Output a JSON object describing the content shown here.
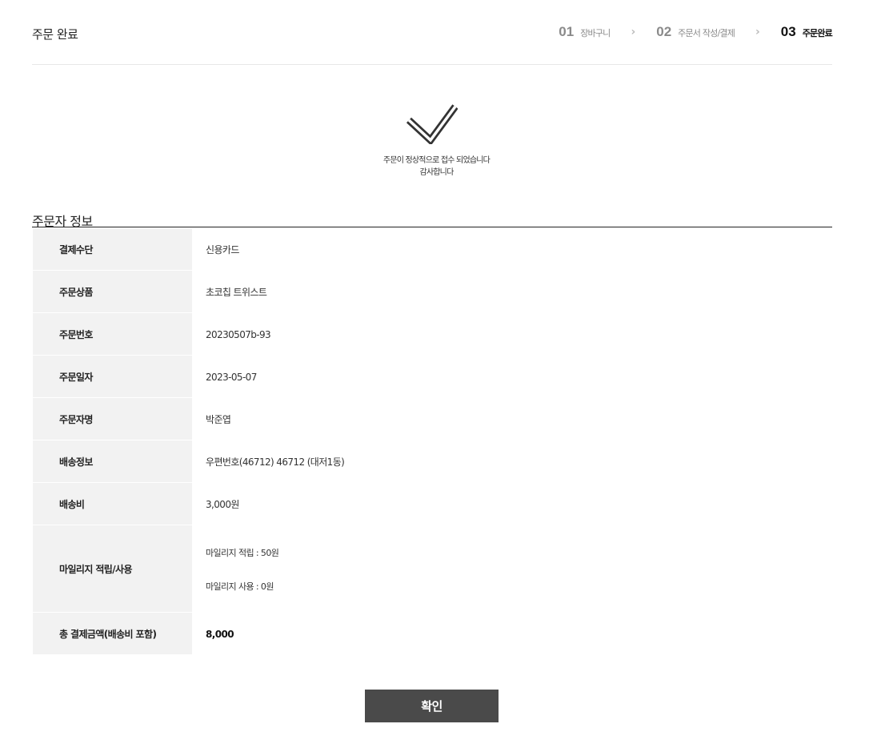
{
  "header": {
    "title": "주문 완료",
    "steps": [
      {
        "num": "01",
        "label": "장바구니"
      },
      {
        "num": "02",
        "label": "주문서 작성/결제"
      },
      {
        "num": "03",
        "label": "주문완료"
      }
    ],
    "separator": "›"
  },
  "complete": {
    "icon": "check-icon",
    "line1": "주문이 정상적으로 접수 되었습니다",
    "line2": "감사합니다"
  },
  "orderer_info": {
    "title": "주문자 정보",
    "rows": [
      {
        "label": "결제수단",
        "value": "신용카드"
      },
      {
        "label": "주문상품",
        "value": "초코칩 트위스트"
      },
      {
        "label": "주문번호",
        "value": "20230507b-93"
      },
      {
        "label": "주문일자",
        "value": "2023-05-07"
      },
      {
        "label": "주문자명",
        "value": "박준엽"
      },
      {
        "label": "배송정보",
        "value": "우편번호(46712) 46712 (대저1동)"
      },
      {
        "label": "배송비",
        "value": "3,000원"
      },
      {
        "label": "마일리지 적립/사용",
        "value": "마일리지 적립 : 50원",
        "value2": "마일리지 사용 : 0원"
      },
      {
        "label": "총 결제금액(배송비 포함)",
        "value": "8,000"
      }
    ]
  },
  "actions": {
    "confirm_label": "확인"
  }
}
